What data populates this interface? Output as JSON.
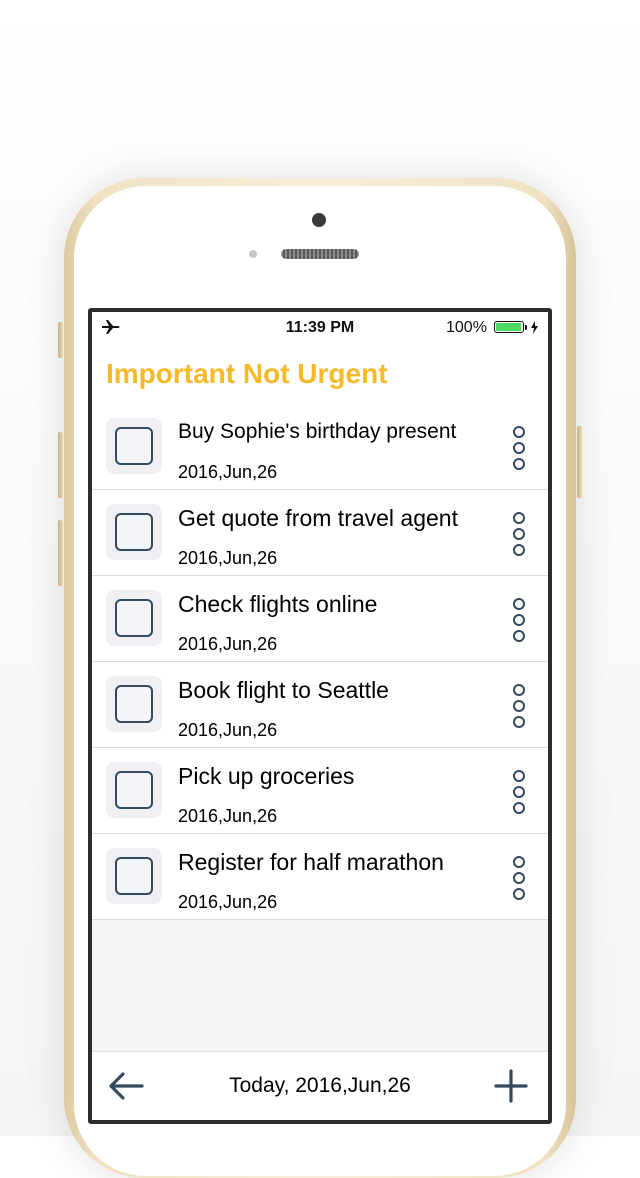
{
  "status_bar": {
    "time": "11:39 PM",
    "battery_percent": "100%",
    "battery_level": 1.0,
    "icons": [
      "airplane-icon",
      "battery-icon",
      "charging-bolt-icon"
    ]
  },
  "header": {
    "title": "Important Not Urgent",
    "title_color": "#f6b928"
  },
  "tasks": [
    {
      "title": "Buy Sophie's birthday present",
      "date": "2016,Jun,26"
    },
    {
      "title": "Get quote from travel agent",
      "date": "2016,Jun,26"
    },
    {
      "title": "Check flights online",
      "date": "2016,Jun,26"
    },
    {
      "title": "Book flight to Seattle",
      "date": "2016,Jun,26"
    },
    {
      "title": "Pick up groceries",
      "date": "2016,Jun,26"
    },
    {
      "title": "Register for half marathon",
      "date": "2016,Jun,26"
    }
  ],
  "bottom_bar": {
    "today_label": "Today, 2016,Jun,26",
    "back_icon": "arrow-left-icon",
    "add_icon": "plus-icon"
  },
  "colors": {
    "accent": "#f6b928",
    "icon": "#34495e"
  }
}
